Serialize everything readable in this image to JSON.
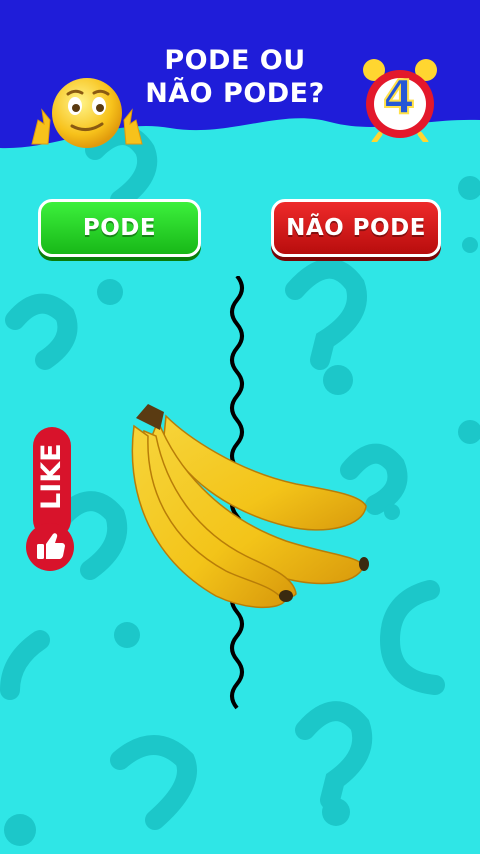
{
  "header": {
    "title_line1": "PODE OU",
    "title_line2": "NÃO PODE?",
    "background_color": "#1f1dd9"
  },
  "timer": {
    "value": "4",
    "icon": "alarm-clock-icon"
  },
  "emoji": {
    "icon": "thinking-smiley-emoji-icon"
  },
  "choices": {
    "pode_label": "PODE",
    "nao_pode_label": "NÃO PODE",
    "pode_color": "#22cc22",
    "nao_pode_color": "#d31515"
  },
  "like_widget": {
    "label": "LIKE",
    "icon": "thumbs-up-icon"
  },
  "item": {
    "icon": "banana-bunch-icon"
  },
  "divider": {
    "icon": "wavy-divider-line"
  },
  "background": {
    "color": "#2fe6e6",
    "pattern": "question-mark-pattern"
  }
}
